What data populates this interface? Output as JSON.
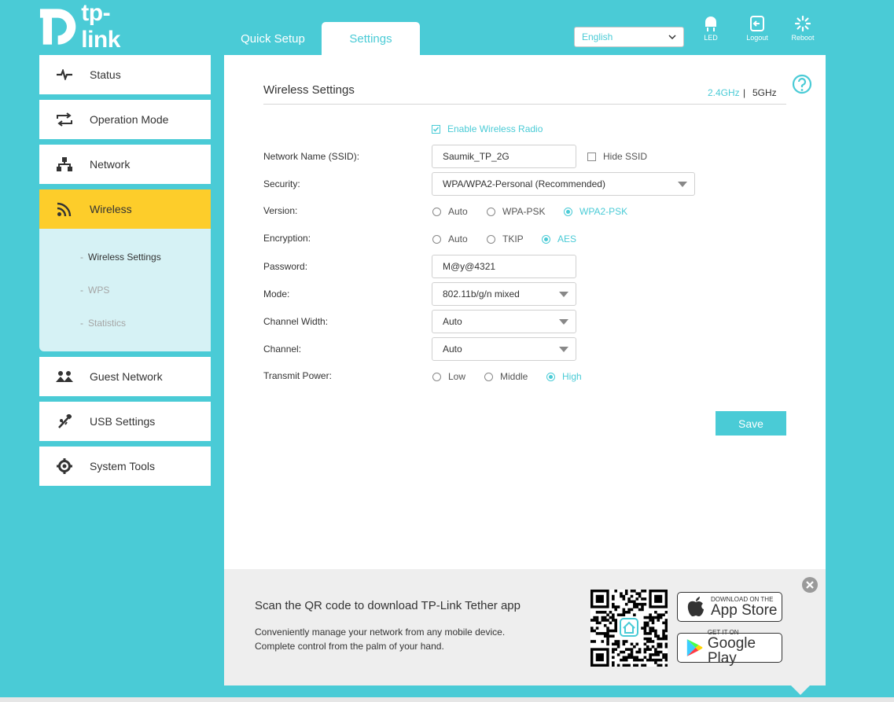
{
  "brand": {
    "logo_text": "tp-link",
    "accent": "#4acbd6",
    "active_menu": "#fdcd2a"
  },
  "tabs": [
    {
      "label": "Quick Setup"
    },
    {
      "label": "Settings"
    }
  ],
  "language": {
    "selected": "English"
  },
  "top_buttons": [
    {
      "label": "LED",
      "icon": "lightbulb-icon"
    },
    {
      "label": "Logout",
      "icon": "logout-icon"
    },
    {
      "label": "Reboot",
      "icon": "reboot-icon"
    }
  ],
  "sidebar": {
    "items": [
      {
        "label": "Status",
        "icon": "pulse-icon"
      },
      {
        "label": "Operation Mode",
        "icon": "swap-arrows-icon"
      },
      {
        "label": "Network",
        "icon": "network-icon"
      },
      {
        "label": "Wireless",
        "icon": "wifi-icon"
      },
      {
        "label": "Guest Network",
        "icon": "guests-icon"
      },
      {
        "label": "USB Settings",
        "icon": "usb-icon"
      },
      {
        "label": "System Tools",
        "icon": "gear-icon"
      }
    ],
    "wireless_sub": [
      {
        "label": "Wireless Settings"
      },
      {
        "label": "WPS"
      },
      {
        "label": "Statistics"
      }
    ]
  },
  "main": {
    "title": "Wireless Settings",
    "band_24": "2.4GHz",
    "band_sep": "|",
    "band_5": "5GHz",
    "enable_radio": "Enable Wireless Radio",
    "ssid_label": "Network Name (SSID):",
    "ssid_value": "Saumik_TP_2G",
    "hide_ssid": "Hide SSID",
    "security_label": "Security:",
    "security_value": "WPA/WPA2-Personal (Recommended)",
    "version_label": "Version:",
    "version_options": [
      "Auto",
      "WPA-PSK",
      "WPA2-PSK"
    ],
    "encryption_label": "Encryption:",
    "encryption_options": [
      "Auto",
      "TKIP",
      "AES"
    ],
    "password_label": "Password:",
    "password_value": "M@y@4321",
    "mode_label": "Mode:",
    "mode_value": "802.11b/g/n mixed",
    "width_label": "Channel Width:",
    "width_value": "Auto",
    "channel_label": "Channel:",
    "channel_value": "Auto",
    "power_label": "Transmit Power:",
    "power_options": [
      "Low",
      "Middle",
      "High"
    ],
    "save_label": "Save"
  },
  "footer": {
    "title": "Scan the QR code to download TP-Link Tether app",
    "desc1": "Conveniently manage your network from any mobile device.",
    "desc2": "Complete control from the palm of your hand.",
    "appstore_small": "Download on the",
    "appstore_big": "App Store",
    "gplay_small": "GET IT ON",
    "gplay_big": "Google Play"
  }
}
